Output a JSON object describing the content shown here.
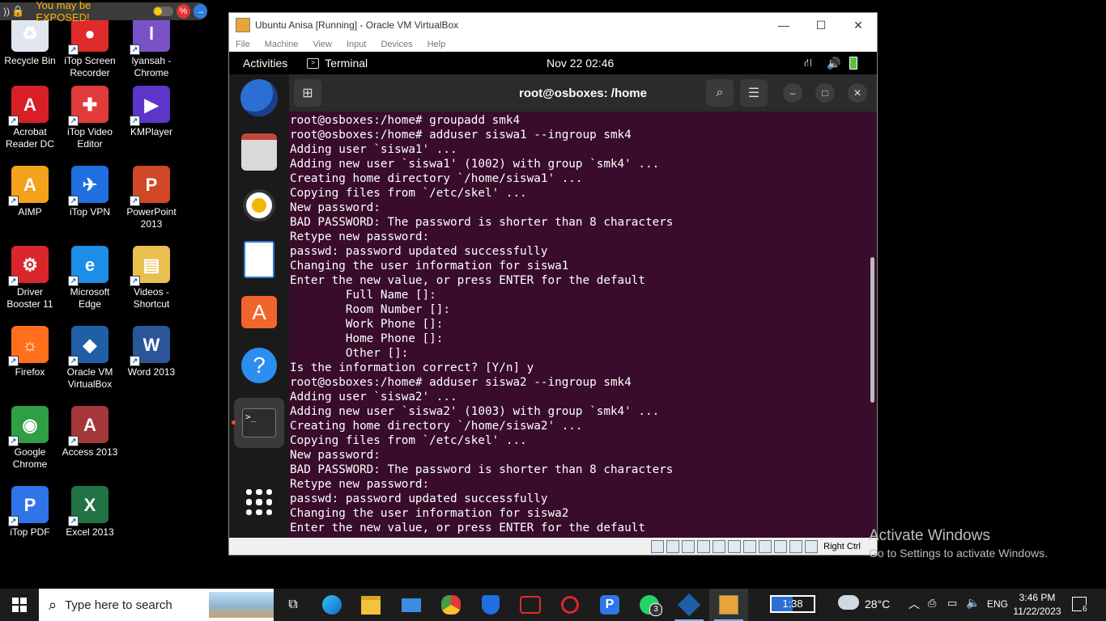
{
  "desktop": {
    "warning_text": "You may be EXPOSED!",
    "icons": [
      {
        "label": "Recycle Bin",
        "color": "#dfe6ee",
        "glyph": "♻"
      },
      {
        "label": "iTop Screen Recorder",
        "color": "#e02b2b",
        "glyph": "●"
      },
      {
        "label": "lyansah - Chrome",
        "color": "#7a52c7",
        "glyph": "l"
      },
      {
        "label": "Acrobat Reader DC",
        "color": "#d81f26",
        "glyph": "A"
      },
      {
        "label": "iTop Video Editor",
        "color": "#e23b3b",
        "glyph": "✚"
      },
      {
        "label": "KMPlayer",
        "color": "#5b36c9",
        "glyph": "▶"
      },
      {
        "label": "AIMP",
        "color": "#f4a11d",
        "glyph": "A"
      },
      {
        "label": "iTop VPN",
        "color": "#1f6fe0",
        "glyph": "✈"
      },
      {
        "label": "PowerPoint 2013",
        "color": "#d24726",
        "glyph": "P"
      },
      {
        "label": "Driver Booster 11",
        "color": "#d9262c",
        "glyph": "⚙"
      },
      {
        "label": "Microsoft Edge",
        "color": "#1c8ee8",
        "glyph": "e"
      },
      {
        "label": "Videos - Shortcut",
        "color": "#e9c04f",
        "glyph": "▤"
      },
      {
        "label": "Firefox",
        "color": "#ff6f1c",
        "glyph": "☼"
      },
      {
        "label": "Oracle VM VirtualBox",
        "color": "#1e5fa6",
        "glyph": "◆"
      },
      {
        "label": "Word 2013",
        "color": "#2b579a",
        "glyph": "W"
      },
      {
        "label": "Google Chrome",
        "color": "#2f9e44",
        "glyph": "◉"
      },
      {
        "label": "Access 2013",
        "color": "#a4373a",
        "glyph": "A"
      },
      {
        "label": "iTop PDF",
        "color": "#2f74e8",
        "glyph": "P"
      },
      {
        "label": "Excel 2013",
        "color": "#217346",
        "glyph": "X"
      }
    ]
  },
  "vbox": {
    "title": "Ubuntu Anisa [Running] - Oracle VM VirtualBox",
    "menu": [
      "File",
      "Machine",
      "View",
      "Input",
      "Devices",
      "Help"
    ],
    "status_label": "Right Ctrl"
  },
  "guest": {
    "activities": "Activities",
    "app_name": "Terminal",
    "clock": "Nov 22  02:46",
    "terminal_title": "root@osboxes: /home",
    "terminal_lines": [
      "root@osboxes:/home# groupadd smk4",
      "root@osboxes:/home# adduser siswa1 --ingroup smk4",
      "Adding user `siswa1' ...",
      "Adding new user `siswa1' (1002) with group `smk4' ...",
      "Creating home directory `/home/siswa1' ...",
      "Copying files from `/etc/skel' ...",
      "New password:",
      "BAD PASSWORD: The password is shorter than 8 characters",
      "Retype new password:",
      "passwd: password updated successfully",
      "Changing the user information for siswa1",
      "Enter the new value, or press ENTER for the default",
      "        Full Name []:",
      "        Room Number []:",
      "        Work Phone []:",
      "        Home Phone []:",
      "        Other []:",
      "Is the information correct? [Y/n] y",
      "root@osboxes:/home# adduser siswa2 --ingroup smk4",
      "Adding user `siswa2' ...",
      "Adding new user `siswa2' (1003) with group `smk4' ...",
      "Creating home directory `/home/siswa2' ...",
      "Copying files from `/etc/skel' ...",
      "New password:",
      "BAD PASSWORD: The password is shorter than 8 characters",
      "Retype new password:",
      "passwd: password updated successfully",
      "Changing the user information for siswa2",
      "Enter the new value, or press ENTER for the default"
    ]
  },
  "activate": {
    "title": "Activate Windows",
    "subtitle": "Go to Settings to activate Windows."
  },
  "taskbar": {
    "search_placeholder": "Type here to search",
    "battery_time": "1:38",
    "temperature": "28°C",
    "language": "ENG",
    "time": "3:46 PM",
    "date": "11/22/2023",
    "notification_count": "6",
    "whatsapp_badge": "3"
  }
}
